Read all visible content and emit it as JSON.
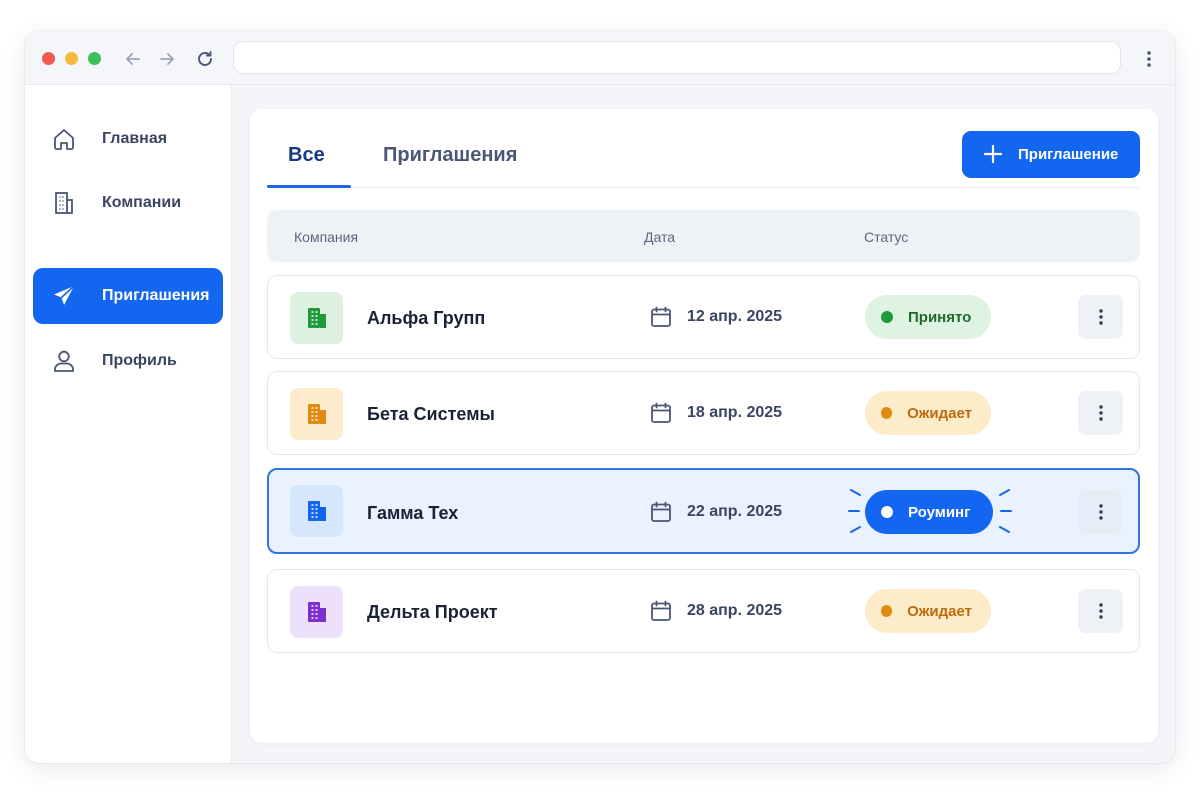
{
  "browser": {
    "address_value": ""
  },
  "sidebar": {
    "items": [
      {
        "label": "Главная",
        "icon": "home-icon"
      },
      {
        "label": "Компании",
        "icon": "building-icon"
      },
      {
        "label": "Приглашения",
        "icon": "send-icon",
        "active": true
      },
      {
        "label": "Профиль",
        "icon": "user-icon"
      }
    ]
  },
  "tabs": [
    {
      "label": "Все",
      "active": true
    },
    {
      "label": "Приглашения",
      "active": false
    }
  ],
  "actions": {
    "invite_label": "Приглашение"
  },
  "table": {
    "headers": [
      "Компания",
      "Дата",
      "Статус"
    ],
    "rows": [
      {
        "company": "Альфа Групп",
        "date": "12 апр. 2025",
        "status": "Принято",
        "icon_color": "#1f9b3b",
        "selected": false
      },
      {
        "company": "Бета Системы",
        "date": "18 апр. 2025",
        "status": "Ожидает",
        "icon_color": "#e18a12",
        "selected": false
      },
      {
        "company": "Гамма Тех",
        "date": "22 апр. 2025",
        "status": "Роуминг",
        "icon_color": "#1366f0",
        "selected": true
      },
      {
        "company": "Дельта Проект",
        "date": "28 апр. 2025",
        "status": "Ожидает",
        "icon_color": "#7b2fd0",
        "selected": false
      }
    ]
  },
  "colors": {
    "accent": "#1366f0",
    "accepted": "#1f9b3b",
    "pending": "#e18a12",
    "purple": "#7b2fd0"
  }
}
